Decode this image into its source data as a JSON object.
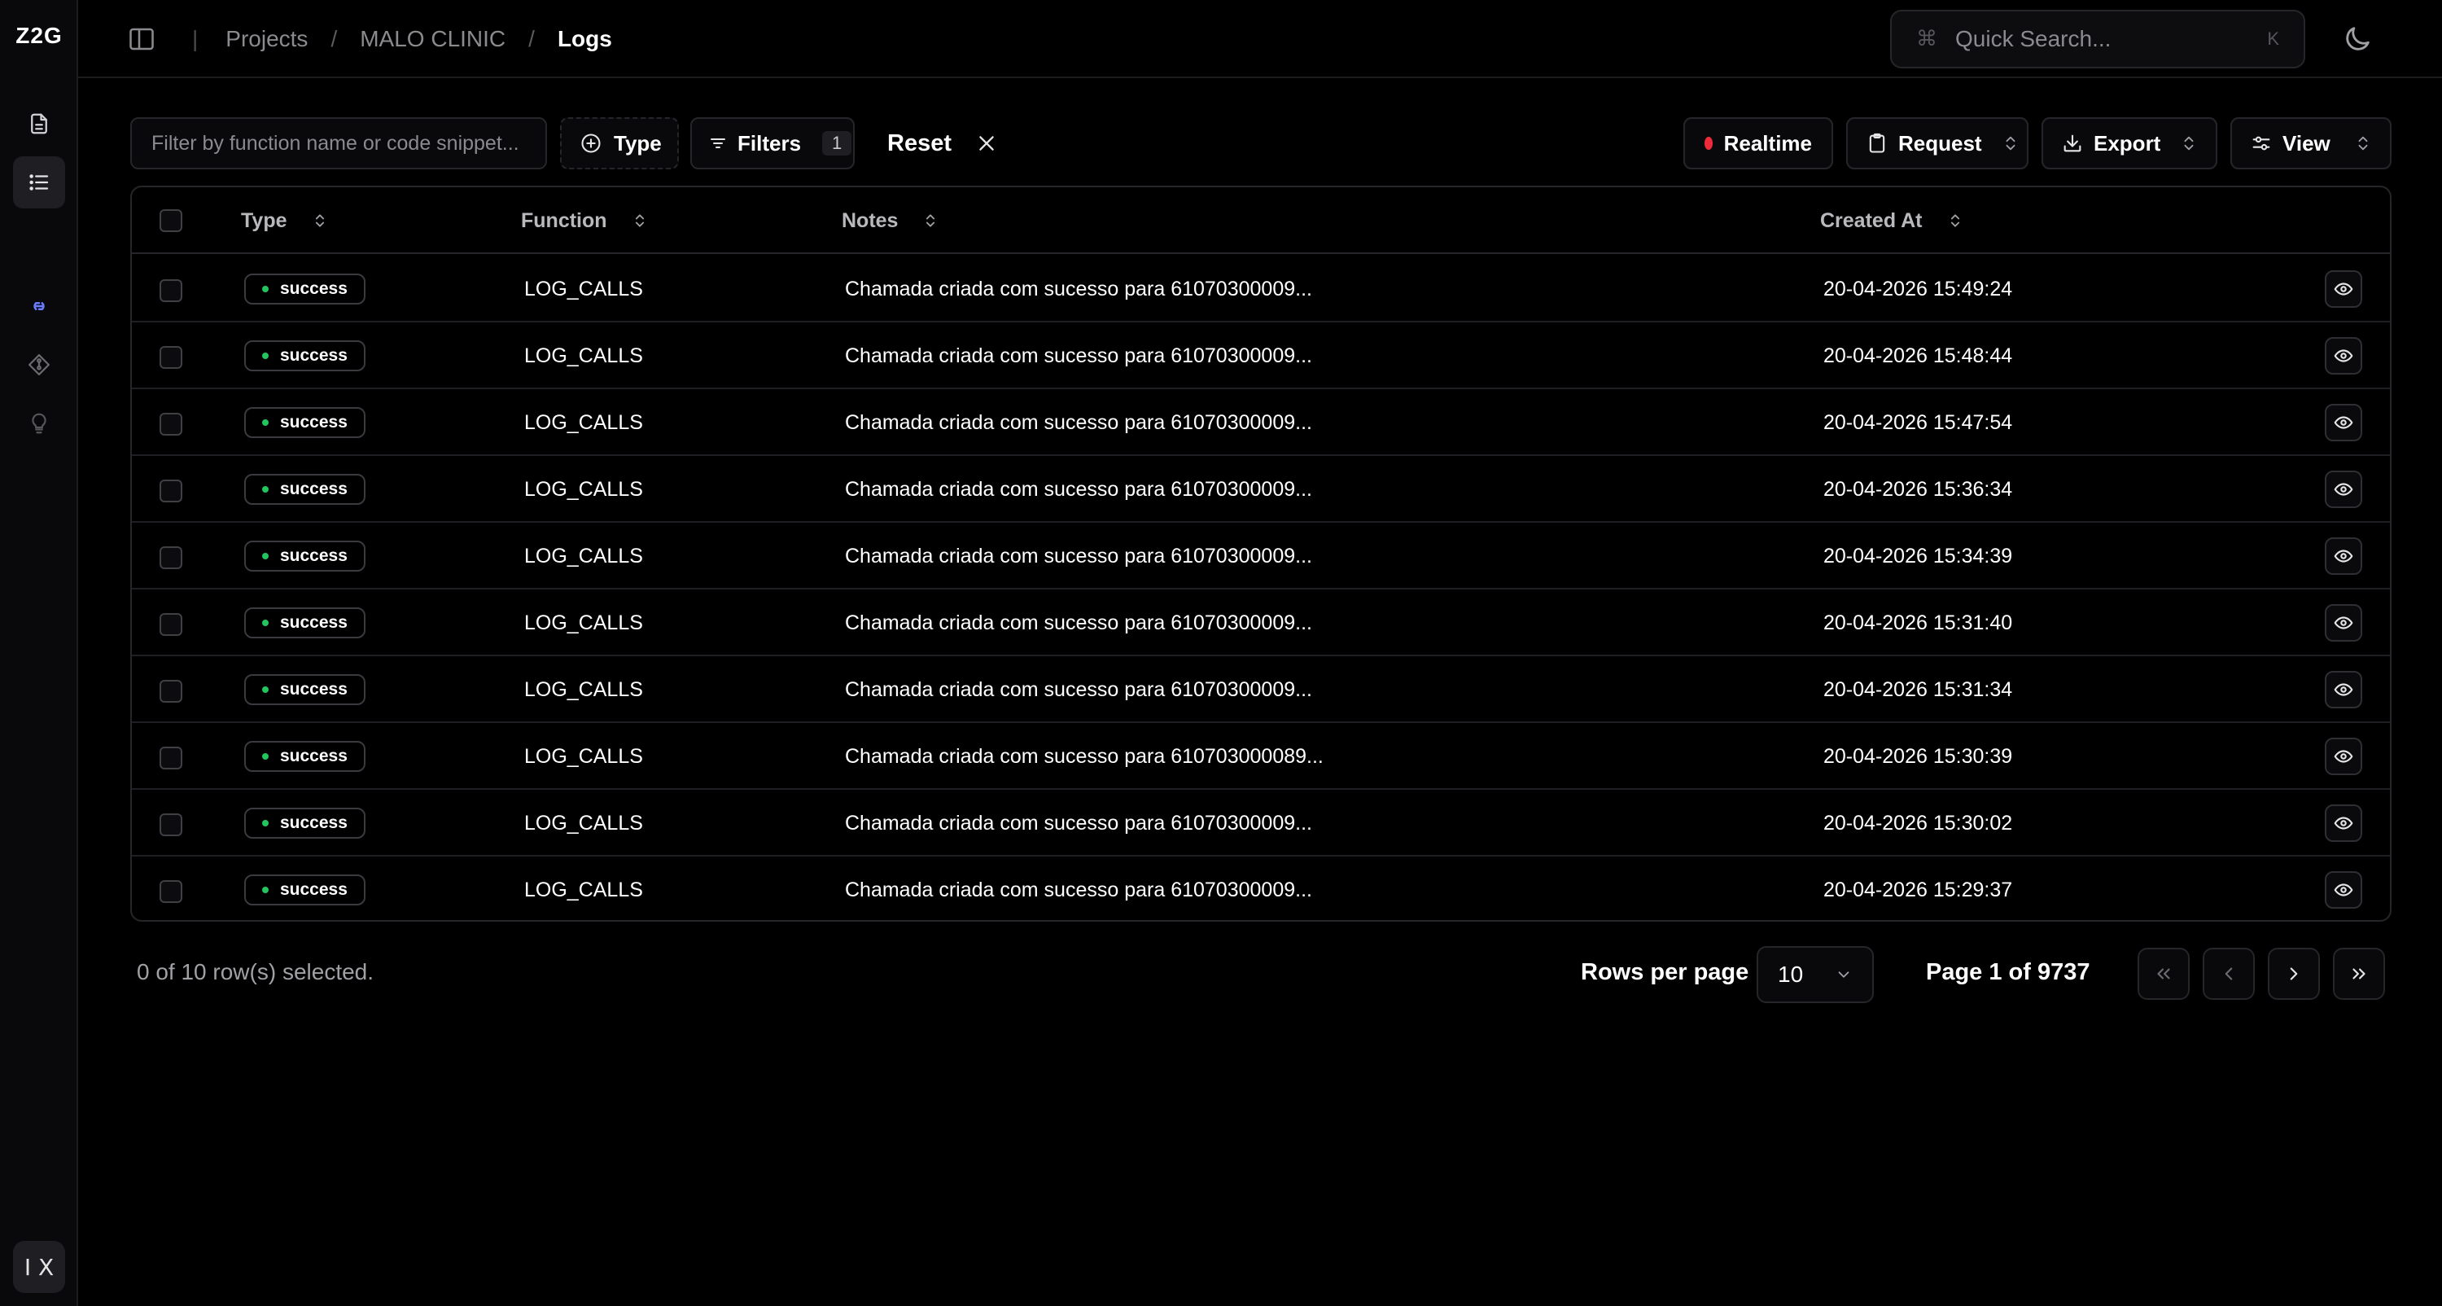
{
  "app": {
    "logo": "Z2G",
    "bottom_badge": "I X"
  },
  "breadcrumb": {
    "items": [
      "Projects",
      "MALO CLINIC",
      "Logs"
    ]
  },
  "search": {
    "placeholder": "Quick Search...",
    "shortcut_symbol": "⌘",
    "shortcut_key": "K"
  },
  "toolbar": {
    "filter_placeholder": "Filter by function name or code snippet...",
    "type_label": "Type",
    "filters_label": "Filters",
    "filters_count": "1",
    "reset_label": "Reset",
    "realtime_label": "Realtime",
    "request_label": "Request",
    "export_label": "Export",
    "view_label": "View"
  },
  "colors": {
    "success_dot": "#22c55e",
    "realtime_dot": "#ef2b3a",
    "active_icon": "#6b7cff"
  },
  "table": {
    "columns": [
      "Type",
      "Function",
      "Notes",
      "Created At"
    ],
    "rows": [
      {
        "type": "success",
        "function": "LOG_CALLS",
        "notes": "Chamada criada com sucesso para 61070300009...",
        "created_at": "20-04-2026 15:49:24"
      },
      {
        "type": "success",
        "function": "LOG_CALLS",
        "notes": "Chamada criada com sucesso para 61070300009...",
        "created_at": "20-04-2026 15:48:44"
      },
      {
        "type": "success",
        "function": "LOG_CALLS",
        "notes": "Chamada criada com sucesso para 61070300009...",
        "created_at": "20-04-2026 15:47:54"
      },
      {
        "type": "success",
        "function": "LOG_CALLS",
        "notes": "Chamada criada com sucesso para 61070300009...",
        "created_at": "20-04-2026 15:36:34"
      },
      {
        "type": "success",
        "function": "LOG_CALLS",
        "notes": "Chamada criada com sucesso para 61070300009...",
        "created_at": "20-04-2026 15:34:39"
      },
      {
        "type": "success",
        "function": "LOG_CALLS",
        "notes": "Chamada criada com sucesso para 61070300009...",
        "created_at": "20-04-2026 15:31:40"
      },
      {
        "type": "success",
        "function": "LOG_CALLS",
        "notes": "Chamada criada com sucesso para 61070300009...",
        "created_at": "20-04-2026 15:31:34"
      },
      {
        "type": "success",
        "function": "LOG_CALLS",
        "notes": "Chamada criada com sucesso para 610703000089...",
        "created_at": "20-04-2026 15:30:39"
      },
      {
        "type": "success",
        "function": "LOG_CALLS",
        "notes": "Chamada criada com sucesso para 61070300009...",
        "created_at": "20-04-2026 15:30:02"
      },
      {
        "type": "success",
        "function": "LOG_CALLS",
        "notes": "Chamada criada com sucesso para 61070300009...",
        "created_at": "20-04-2026 15:29:37"
      }
    ]
  },
  "footer": {
    "selection_text": "0 of 10 row(s) selected.",
    "rows_per_page_label": "Rows per page",
    "rows_per_page_value": "10",
    "page_info": "Page 1 of 9737"
  }
}
